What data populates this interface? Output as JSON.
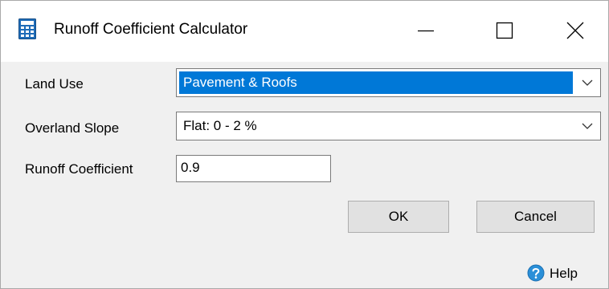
{
  "window": {
    "title": "Runoff Coefficient Calculator",
    "icon": "calculator-icon",
    "controls": [
      "minimize-icon",
      "maximize-icon",
      "close-icon"
    ]
  },
  "form": {
    "land_use": {
      "label": "Land Use",
      "value": "Pavement & Roofs"
    },
    "overland_slope": {
      "label": "Overland Slope",
      "value": "Flat: 0 - 2 %"
    },
    "runoff_coefficient": {
      "label": "Runoff Coefficient",
      "value": "0.9"
    }
  },
  "buttons": {
    "ok": "OK",
    "cancel": "Cancel"
  },
  "help": {
    "label": "Help",
    "icon": "help-icon"
  },
  "colors": {
    "selection": "#0078d7",
    "dialog_background": "#f0f0f0",
    "title_background": "#ffffff",
    "button_face": "#e1e1e1",
    "help_icon": "#2a8fd8"
  }
}
